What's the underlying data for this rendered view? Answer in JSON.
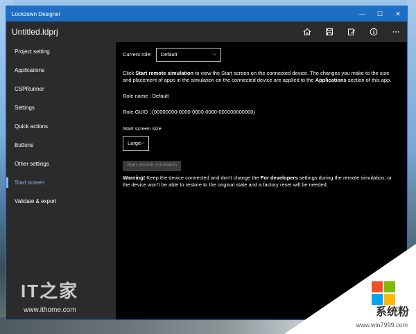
{
  "window": {
    "title": "Lockdown Designer",
    "min": "—",
    "max": "☐",
    "close": "✕"
  },
  "appbar": {
    "document_name": "Untitled.ldprj"
  },
  "sidebar": {
    "items": [
      {
        "label": "Project setting"
      },
      {
        "label": "Applications"
      },
      {
        "label": "CSPRunner"
      },
      {
        "label": "Settings"
      },
      {
        "label": "Quick actions"
      },
      {
        "label": "Buttons"
      },
      {
        "label": "Other settings"
      },
      {
        "label": "Start screen"
      },
      {
        "label": "Validate & export"
      }
    ],
    "active": "Start screen"
  },
  "content": {
    "current_role_label": "Current role:",
    "current_role_value": "Default",
    "desc_prefix": "Click ",
    "desc_bold1": "Start remote simulation",
    "desc_mid": " to view the Start screen on the connected device.  The changes you make to the size and placement of apps in the simulation on the connected device are applied to the ",
    "desc_bold2": "Applications",
    "desc_suffix": " section of this app.",
    "role_name": "Role name : Default",
    "role_guid": "Role GUID : {00000000-0000-0000-0000-000000000000}",
    "size_label": "Start screen size",
    "size_value": "Large",
    "start_button": "Start remote simulation",
    "warn_bold": "Warning!",
    "warn_text1": " Keep the device connected and don't change the ",
    "warn_bold2": "For developers",
    "warn_text2": " settings during the remote simulation, or the device won't be able to restore to the original state and a factory reset will be needed."
  },
  "watermark": {
    "it": "IT之家",
    "url": "www.ithome.com",
    "cn": "系统粉",
    "cn_url": "www.win7999.com"
  },
  "colors": {
    "accent": "#1e6fc3",
    "active_nav": "#7ab8ff"
  },
  "icons": {
    "home": "home-icon",
    "save": "save-icon",
    "edit": "edit-icon",
    "info": "info-icon",
    "more": "more-icon"
  }
}
